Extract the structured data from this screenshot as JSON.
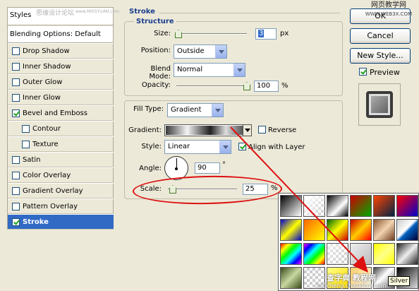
{
  "sidebar": {
    "header": "Styles",
    "blending": "Blending Options: Default",
    "items": [
      {
        "label": "Drop Shadow",
        "checked": false
      },
      {
        "label": "Inner Shadow",
        "checked": false
      },
      {
        "label": "Outer Glow",
        "checked": false
      },
      {
        "label": "Inner Glow",
        "checked": false
      },
      {
        "label": "Bevel and Emboss",
        "checked": true
      },
      {
        "label": "Contour",
        "checked": false
      },
      {
        "label": "Texture",
        "checked": false
      },
      {
        "label": "Satin",
        "checked": false
      },
      {
        "label": "Color Overlay",
        "checked": false
      },
      {
        "label": "Gradient Overlay",
        "checked": false
      },
      {
        "label": "Pattern Overlay",
        "checked": false
      },
      {
        "label": "Stroke",
        "checked": true
      }
    ]
  },
  "stroke": {
    "title": "Stroke",
    "structure": {
      "title": "Structure",
      "size_label": "Size:",
      "size_value": "3",
      "size_unit": "px",
      "position_label": "Position:",
      "position_value": "Outside",
      "blend_label": "Blend Mode:",
      "blend_value": "Normal",
      "opacity_label": "Opacity:",
      "opacity_value": "100",
      "opacity_unit": "%"
    },
    "fill": {
      "type_label": "Fill Type:",
      "type_value": "Gradient",
      "gradient_label": "Gradient:",
      "reverse_label": "Reverse",
      "reverse_checked": false,
      "style_label": "Style:",
      "style_value": "Linear",
      "align_label": "Align with Layer",
      "align_checked": true,
      "angle_label": "Angle:",
      "angle_value": "90",
      "angle_unit": "°",
      "scale_label": "Scale:",
      "scale_value": "25",
      "scale_unit": "%"
    }
  },
  "buttons": {
    "ok": "OK",
    "cancel": "Cancel",
    "new_style": "New Style...",
    "preview": "Preview"
  },
  "watermark": {
    "top": "网页教学网",
    "top_url": "WWW.WEB3X.COM",
    "left": "思缘设计论坛",
    "left_url": "www.MISSYUAN.com",
    "bottom": "查字典 教程网",
    "bottom_url": "jiaocheng.chazidian.com"
  },
  "tooltip": "Silver",
  "colors": {
    "accent": "#316ac5",
    "group_title": "#1c3e8c",
    "annotation": "#dd1111",
    "background": "#ece9d8"
  }
}
